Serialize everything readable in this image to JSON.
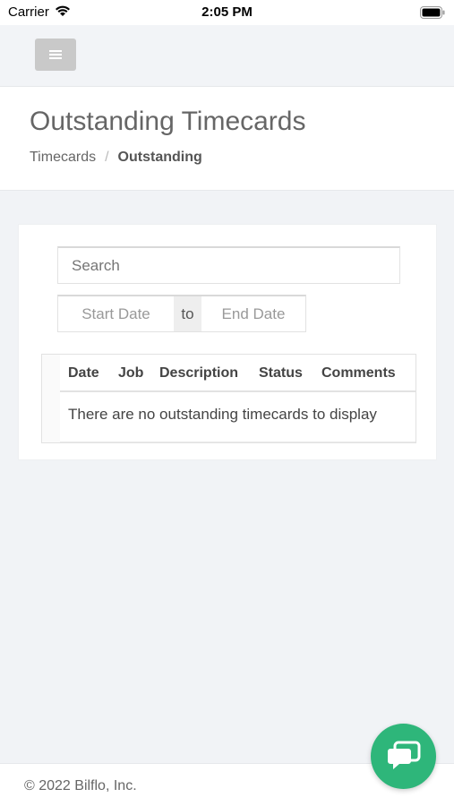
{
  "status_bar": {
    "carrier": "Carrier",
    "time": "2:05 PM"
  },
  "topbar": {
    "menu_icon": "hamburger-icon"
  },
  "header": {
    "title": "Outstanding Timecards",
    "breadcrumb": {
      "parent": "Timecards",
      "separator": "/",
      "current": "Outstanding"
    }
  },
  "filters": {
    "search_placeholder": "Search",
    "start_date_placeholder": "Start Date",
    "to_label": "to",
    "end_date_placeholder": "End Date"
  },
  "table": {
    "columns": [
      "Date",
      "Job",
      "Description",
      "Status",
      "Comments"
    ],
    "empty_message": "There are no outstanding timecards to display"
  },
  "footer": {
    "copyright": "© 2022 Bilflo, Inc."
  },
  "chat": {
    "icon": "chat-bubble-icon",
    "color": "#2eb67a"
  }
}
